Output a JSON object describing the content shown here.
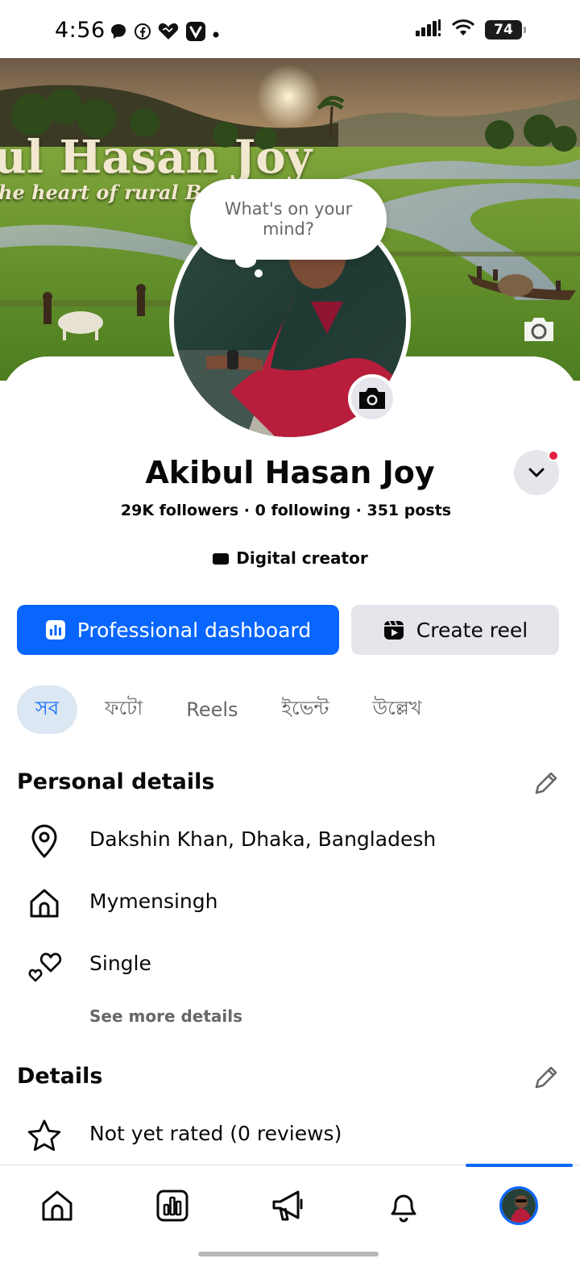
{
  "status_bar": {
    "time": "4:56",
    "battery": "74",
    "notification_icons": [
      "chat-bubble-icon",
      "facebook-icon",
      "heart-icon",
      "v-app-icon",
      "dot-icon"
    ],
    "right_icons": [
      "signal-icon",
      "wifi-icon",
      "battery-icon"
    ]
  },
  "cover": {
    "title_text": "ul Hasan Joy",
    "subtitle_text": "he heart of rural Bangla"
  },
  "bubble": {
    "text": "What's on your mind?"
  },
  "profile": {
    "name": "Akibul Hasan Joy",
    "stats": "29K followers · 0 following · 351 posts",
    "category": "Digital creator"
  },
  "actions": {
    "primary_label": "Professional dashboard",
    "secondary_label": "Create reel"
  },
  "tabs": [
    {
      "label": "সব",
      "active": true
    },
    {
      "label": "ফটো",
      "active": false
    },
    {
      "label": "Reels",
      "active": false
    },
    {
      "label": "ইভেন্ট",
      "active": false
    },
    {
      "label": "উল্লেখ",
      "active": false
    }
  ],
  "personal_details": {
    "title": "Personal details",
    "items": [
      {
        "icon": "location-pin-icon",
        "text": "Dakshin Khan, Dhaka, Bangladesh"
      },
      {
        "icon": "home-icon",
        "text": "Mymensingh"
      },
      {
        "icon": "relationship-hearts-icon",
        "text": "Single"
      }
    ],
    "see_more": "See more details"
  },
  "details": {
    "title": "Details",
    "items": [
      {
        "icon": "star-icon",
        "text": "Not yet rated (0 reviews)"
      }
    ]
  },
  "bottom_nav": {
    "items": [
      "home-icon",
      "dashboard-icon",
      "megaphone-icon",
      "bell-icon",
      "profile-avatar"
    ],
    "active": "profile-avatar"
  },
  "colors": {
    "primary_blue": "#0866ff",
    "secondary_gray": "#e4e6eb",
    "text_primary": "#080809",
    "text_secondary": "#65676b",
    "notification_red": "#e41e3f"
  }
}
